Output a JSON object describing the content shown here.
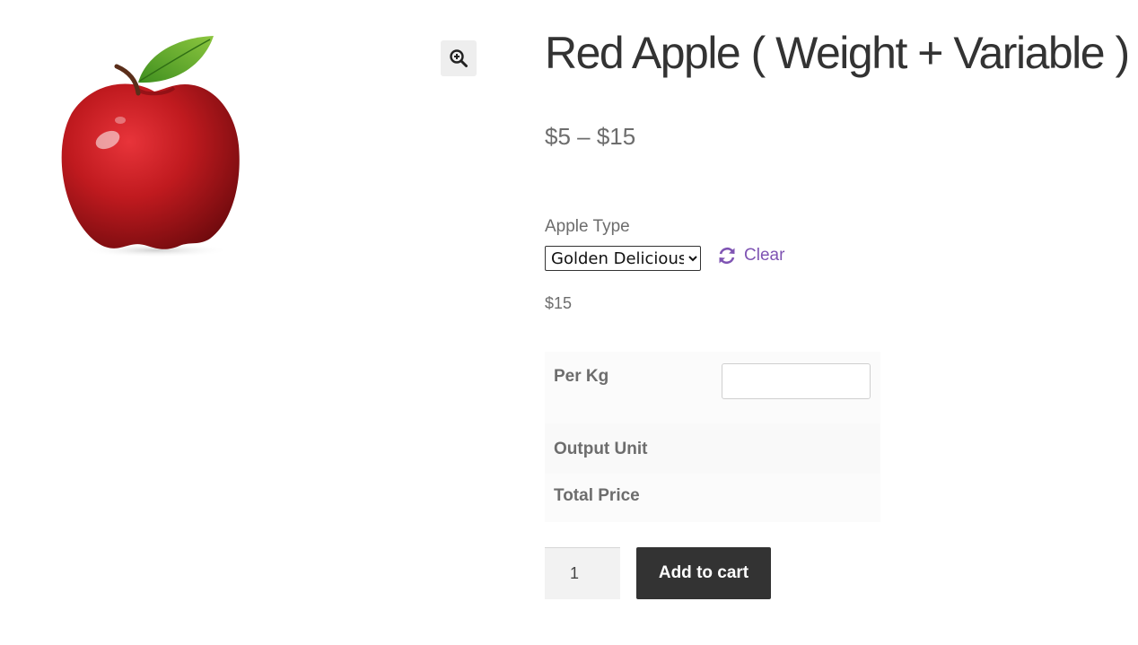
{
  "product": {
    "title": "Red Apple ( Weight + Variable )",
    "price_range": "$5 – $15",
    "image_name": "red-apple-image",
    "zoom_icon": "magnify-plus-icon"
  },
  "variations": {
    "attribute_label": "Apple Type",
    "selected_option": "Golden Delicious",
    "options": [
      "Golden Delicious"
    ],
    "reset_label": "Clear",
    "reset_icon": "refresh-icon",
    "variation_price": "$15"
  },
  "weight_calculator": {
    "rows": [
      {
        "label": "Per Kg",
        "value": ""
      },
      {
        "label": "Output Unit"
      },
      {
        "label": "Total Price"
      }
    ]
  },
  "cart": {
    "quantity": "1",
    "add_to_cart_label": "Add to cart"
  },
  "colors": {
    "title": "#333333",
    "text": "#6d6d6d",
    "link": "#7f54b3",
    "button_bg": "#333333",
    "button_text": "#ffffff"
  }
}
